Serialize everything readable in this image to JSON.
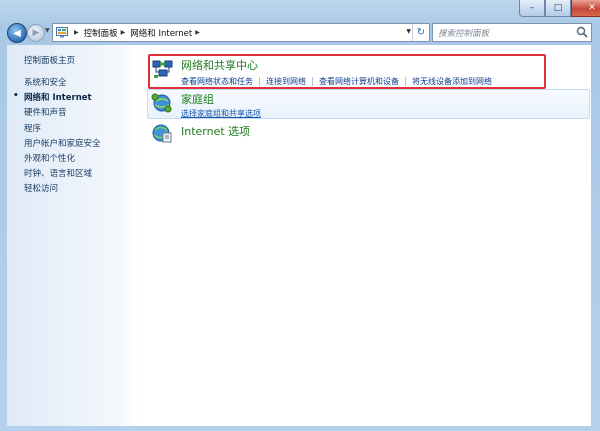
{
  "window": {
    "minimize_glyph": "–",
    "maximize_glyph": "□",
    "close_glyph": "✕"
  },
  "nav": {
    "back_glyph": "◀",
    "forward_glyph": "▶",
    "dropdown_glyph": "▼",
    "refresh_glyph": "↻"
  },
  "address": {
    "icon": "control-panel-icon",
    "breadcrumbs": [
      {
        "label": "控制面板"
      },
      {
        "label": "网络和 Internet"
      }
    ],
    "sep_glyph": "▶"
  },
  "search": {
    "placeholder": "搜索控制面板",
    "icon": "search-icon"
  },
  "sidebar": {
    "items": [
      {
        "label": "控制面板主页",
        "active": false
      },
      {
        "label": "系统和安全",
        "active": false
      },
      {
        "label": "网络和 Internet",
        "active": true
      },
      {
        "label": "硬件和声音",
        "active": false
      },
      {
        "label": "程序",
        "active": false
      },
      {
        "label": "用户帐户和家庭安全",
        "active": false
      },
      {
        "label": "外观和个性化",
        "active": false
      },
      {
        "label": "时钟、语言和区域",
        "active": false
      },
      {
        "label": "轻松访问",
        "active": false
      }
    ],
    "bullet_glyph": "•"
  },
  "categories": [
    {
      "title": "网络和共享中心",
      "icon": "network-sharing-center-icon",
      "links": [
        "查看网络状态和任务",
        "连接到网络",
        "查看网络计算机和设备",
        "将无线设备添加到网络"
      ]
    },
    {
      "title": "家庭组",
      "icon": "homegroup-icon",
      "links": [
        "选择家庭组和共享选项"
      ]
    },
    {
      "title": "Internet 选项",
      "icon": "internet-options-icon",
      "links": []
    }
  ],
  "colors": {
    "category_title": "#1f7a1f",
    "link": "#0a3c8c",
    "highlight_box": "#e0303a",
    "frame": "#b4d0ec"
  }
}
